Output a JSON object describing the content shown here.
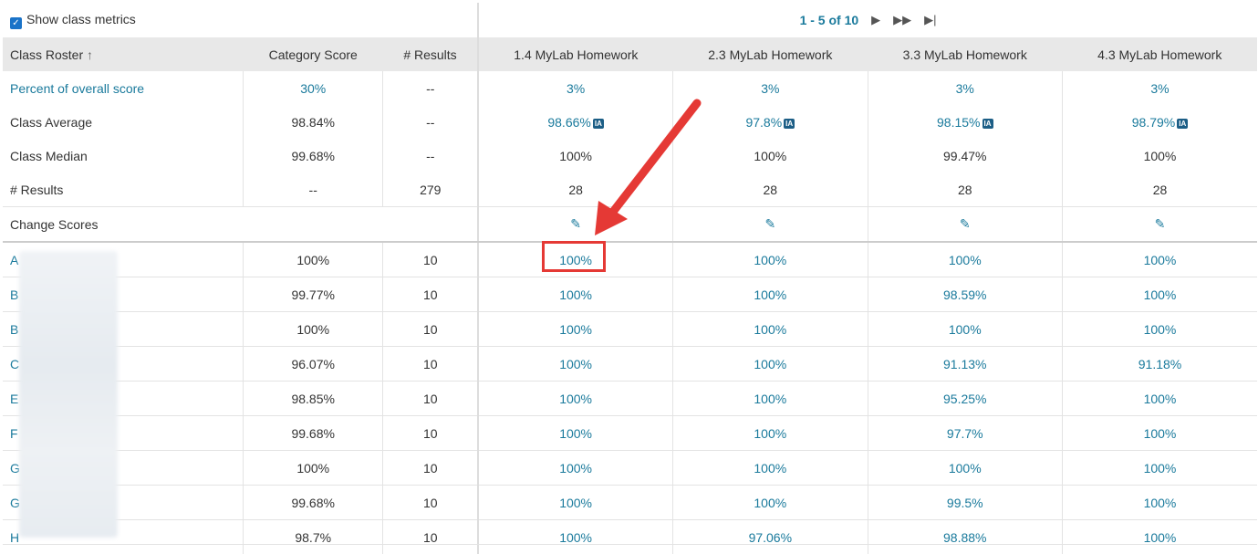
{
  "toolbar": {
    "show_metrics_label": "Show class metrics",
    "checkbox_checked": true,
    "pagination": "1 - 5 of 10"
  },
  "columns": {
    "roster": "Class Roster",
    "category_score": "Category Score",
    "results": "# Results",
    "assignments": [
      "1.4 MyLab Homework",
      "2.3 MyLab Homework",
      "3.3 MyLab Homework",
      "4.3 MyLab Homework"
    ]
  },
  "metrics": [
    {
      "label": "Percent of overall score",
      "category": "30%",
      "results": "--",
      "values": [
        "3%",
        "3%",
        "3%",
        "3%"
      ]
    },
    {
      "label": "Class Average",
      "category": "98.84%",
      "results": "--",
      "values": [
        "98.66%",
        "97.8%",
        "98.15%",
        "98.79%"
      ],
      "badge": "IA"
    },
    {
      "label": "Class Median",
      "category": "99.68%",
      "results": "--",
      "values": [
        "100%",
        "100%",
        "99.47%",
        "100%"
      ]
    },
    {
      "label": "# Results",
      "category": "--",
      "results": "279",
      "values": [
        "28",
        "28",
        "28",
        "28"
      ]
    }
  ],
  "change_scores_label": "Change Scores",
  "students": [
    {
      "initial": "A",
      "category": "100%",
      "results": "10",
      "scores": [
        "100%",
        "100%",
        "100%",
        "100%"
      ]
    },
    {
      "initial": "B",
      "category": "99.77%",
      "results": "10",
      "scores": [
        "100%",
        "100%",
        "98.59%",
        "100%"
      ]
    },
    {
      "initial": "B",
      "category": "100%",
      "results": "10",
      "scores": [
        "100%",
        "100%",
        "100%",
        "100%"
      ]
    },
    {
      "initial": "C",
      "category": "96.07%",
      "results": "10",
      "scores": [
        "100%",
        "100%",
        "91.13%",
        "91.18%"
      ]
    },
    {
      "initial": "E",
      "category": "98.85%",
      "results": "10",
      "scores": [
        "100%",
        "100%",
        "95.25%",
        "100%"
      ]
    },
    {
      "initial": "F",
      "category": "99.68%",
      "results": "10",
      "scores": [
        "100%",
        "100%",
        "97.7%",
        "100%"
      ]
    },
    {
      "initial": "G",
      "category": "100%",
      "results": "10",
      "scores": [
        "100%",
        "100%",
        "100%",
        "100%"
      ]
    },
    {
      "initial": "G",
      "category": "99.68%",
      "results": "10",
      "scores": [
        "100%",
        "100%",
        "99.5%",
        "100%"
      ]
    },
    {
      "initial": "H",
      "category": "98.7%",
      "results": "10",
      "scores": [
        "100%",
        "97.06%",
        "98.88%",
        "100%"
      ]
    }
  ],
  "icons": {
    "sort": "sort-arrow-up-icon",
    "next": "next-page-icon",
    "fast_forward": "fast-forward-icon",
    "last": "last-page-icon",
    "edit": "pencil-icon"
  },
  "colors": {
    "link": "#1a7a9c",
    "header_bg": "#e8e8e8",
    "annotation": "#e53935"
  }
}
